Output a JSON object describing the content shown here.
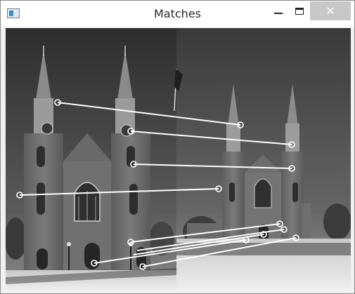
{
  "window": {
    "title": "Matches",
    "close_glyph": "✕"
  },
  "icons": {
    "app": "app-window-icon",
    "minimize": "minimize-icon",
    "maximize": "maximize-icon",
    "close": "close-icon"
  },
  "colors": {
    "match_line": "#ffffff",
    "titlebar": "#ffffff",
    "close_button": "#c7c7c7"
  }
}
